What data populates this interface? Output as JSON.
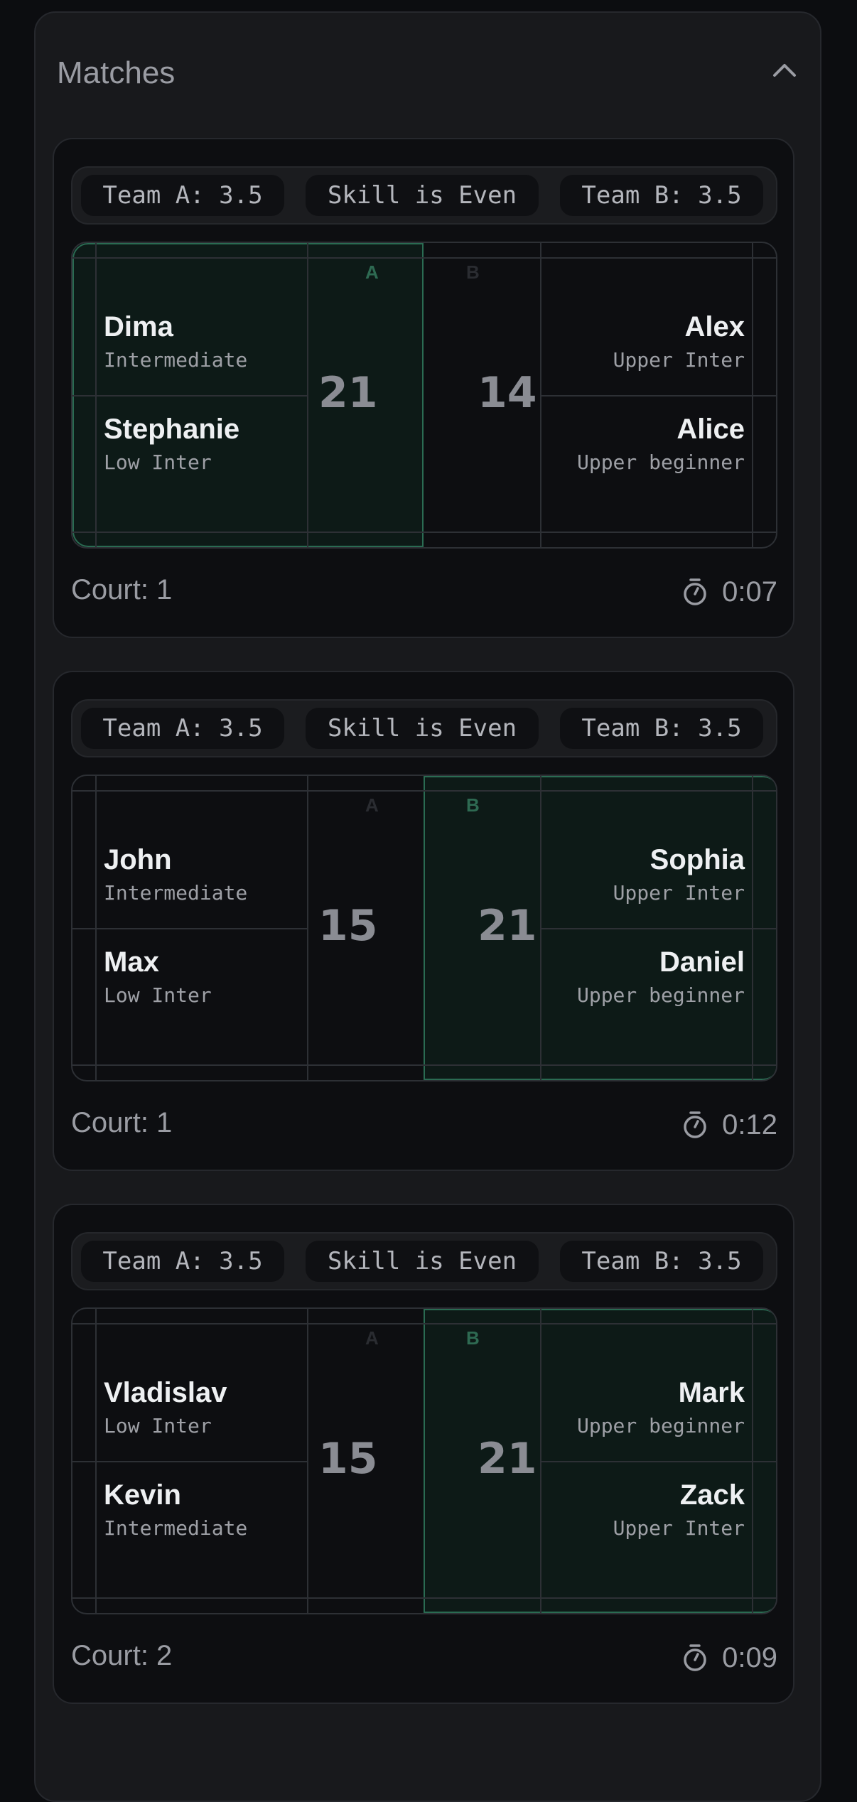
{
  "panel": {
    "title": "Matches"
  },
  "colors": {
    "win_fill": "#0d1a17",
    "win_border": "#2a6b52",
    "card_bg": "#0d0e11"
  },
  "matches": [
    {
      "team_a_label": "Team A: 3.5",
      "skill_label": "Skill is Even",
      "team_b_label": "Team B: 3.5",
      "side_a": "A",
      "side_b": "B",
      "winner": "A",
      "score_a": "21",
      "score_b": "14",
      "team_a": [
        {
          "name": "Dima",
          "level": "Intermediate"
        },
        {
          "name": "Stephanie",
          "level": "Low Inter"
        }
      ],
      "team_b": [
        {
          "name": "Alex",
          "level": "Upper Inter"
        },
        {
          "name": "Alice",
          "level": "Upper beginner"
        }
      ],
      "court": "Court: 1",
      "time": "0:07"
    },
    {
      "team_a_label": "Team A: 3.5",
      "skill_label": "Skill is Even",
      "team_b_label": "Team B: 3.5",
      "side_a": "A",
      "side_b": "B",
      "winner": "B",
      "score_a": "15",
      "score_b": "21",
      "team_a": [
        {
          "name": "John",
          "level": "Intermediate"
        },
        {
          "name": "Max",
          "level": "Low Inter"
        }
      ],
      "team_b": [
        {
          "name": "Sophia",
          "level": "Upper Inter"
        },
        {
          "name": "Daniel",
          "level": "Upper beginner"
        }
      ],
      "court": "Court: 1",
      "time": "0:12"
    },
    {
      "team_a_label": "Team A: 3.5",
      "skill_label": "Skill is Even",
      "team_b_label": "Team B: 3.5",
      "side_a": "A",
      "side_b": "B",
      "winner": "B",
      "score_a": "15",
      "score_b": "21",
      "team_a": [
        {
          "name": "Vladislav",
          "level": "Low Inter"
        },
        {
          "name": "Kevin",
          "level": "Intermediate"
        }
      ],
      "team_b": [
        {
          "name": "Mark",
          "level": "Upper beginner"
        },
        {
          "name": "Zack",
          "level": "Upper Inter"
        }
      ],
      "court": "Court: 2",
      "time": "0:09"
    }
  ]
}
